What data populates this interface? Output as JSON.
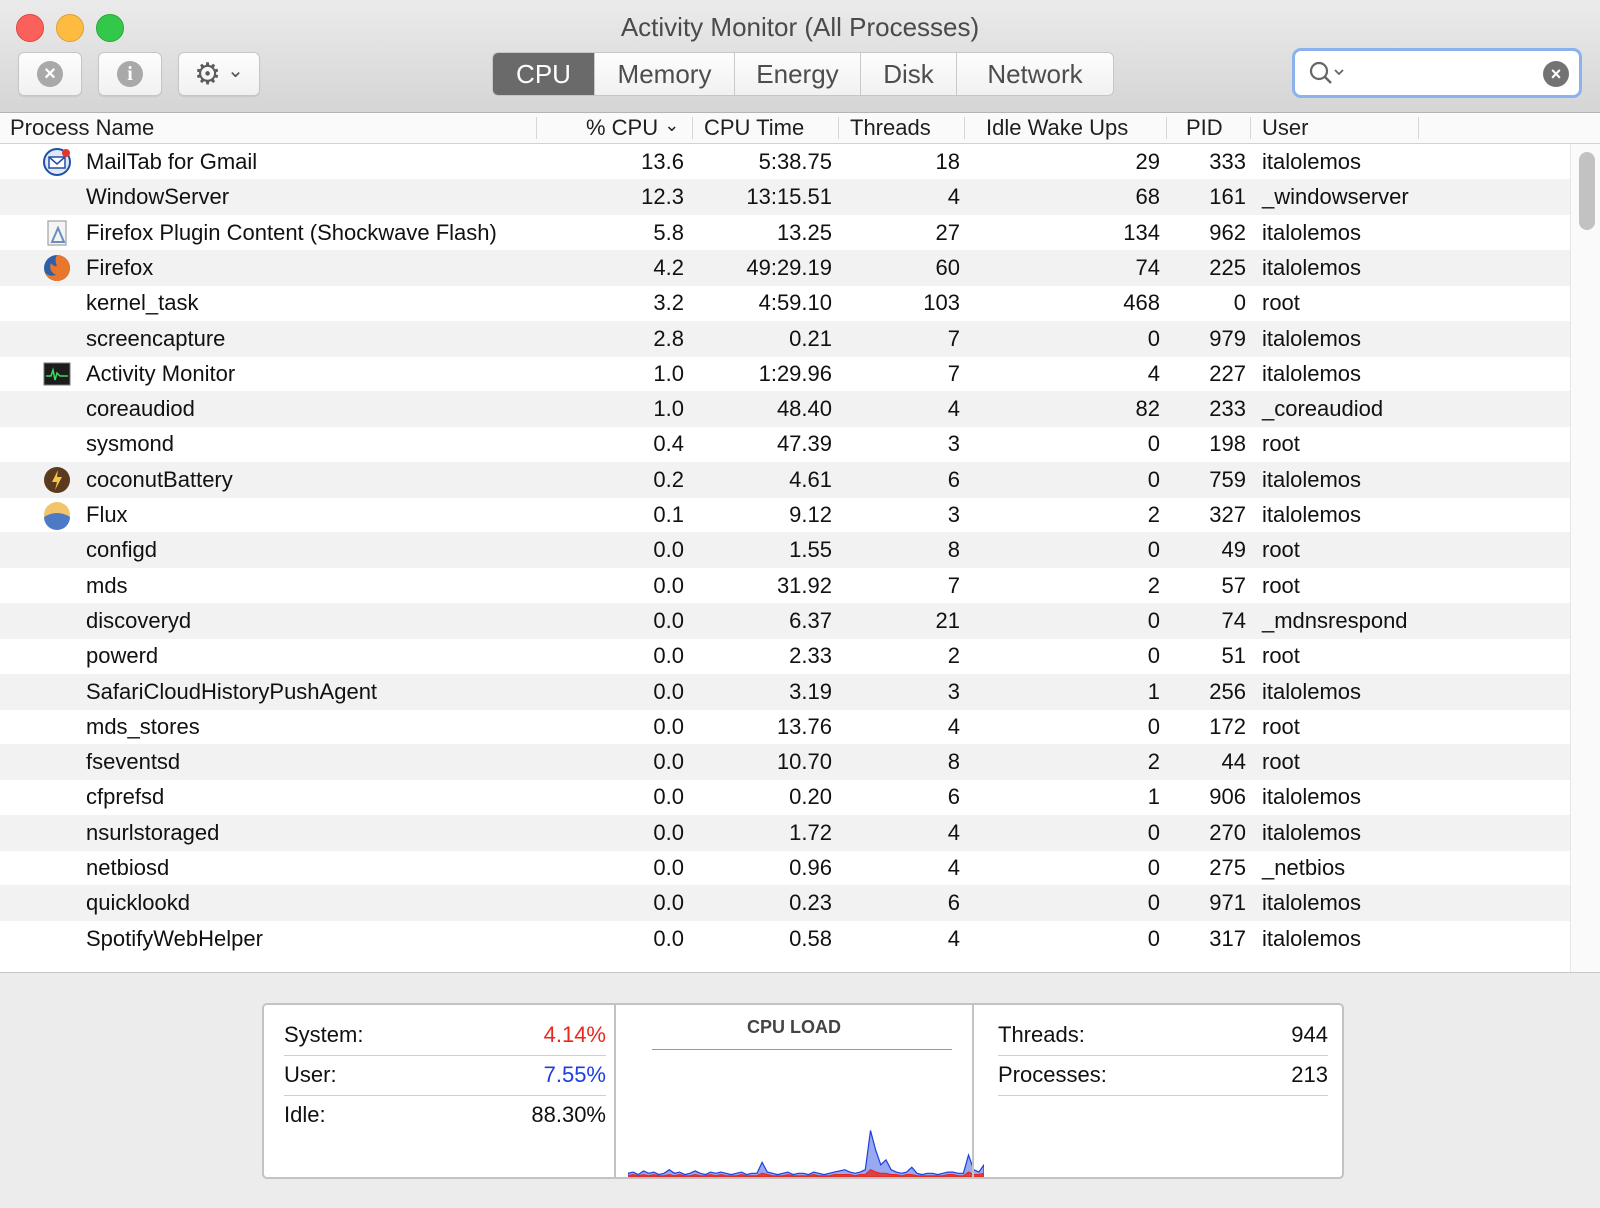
{
  "window": {
    "title": "Activity Monitor (All Processes)"
  },
  "toolbar": {
    "stop_icon": "x-circle-icon",
    "info_icon": "info-icon",
    "gear_icon": "gear-icon",
    "stop_glyph": "×",
    "info_glyph": "i",
    "gear_glyph": "⚙",
    "chevron_glyph": "⌄"
  },
  "tabs": [
    {
      "label": "CPU",
      "active": true
    },
    {
      "label": "Memory",
      "active": false
    },
    {
      "label": "Energy",
      "active": false
    },
    {
      "label": "Disk",
      "active": false
    },
    {
      "label": "Network",
      "active": false
    }
  ],
  "search": {
    "placeholder": "",
    "value": "",
    "clear_glyph": "×"
  },
  "columns": {
    "name": "Process Name",
    "cpu": "% CPU",
    "cpu_sort_glyph": "⌄",
    "time": "CPU Time",
    "threads": "Threads",
    "idle": "Idle Wake Ups",
    "pid": "PID",
    "user": "User"
  },
  "processes": [
    {
      "name": "MailTab for Gmail",
      "cpu": "13.6",
      "time": "5:38.75",
      "threads": "18",
      "idle": "29",
      "pid": "333",
      "user": "italolemos",
      "icon": "mail-icon"
    },
    {
      "name": "WindowServer",
      "cpu": "12.3",
      "time": "13:15.51",
      "threads": "4",
      "idle": "68",
      "pid": "161",
      "user": "_windowserver",
      "icon": ""
    },
    {
      "name": "Firefox Plugin Content (Shockwave Flash)",
      "cpu": "5.8",
      "time": "13.25",
      "threads": "27",
      "idle": "134",
      "pid": "962",
      "user": "italolemos",
      "icon": "plugin-icon"
    },
    {
      "name": "Firefox",
      "cpu": "4.2",
      "time": "49:29.19",
      "threads": "60",
      "idle": "74",
      "pid": "225",
      "user": "italolemos",
      "icon": "firefox-icon"
    },
    {
      "name": "kernel_task",
      "cpu": "3.2",
      "time": "4:59.10",
      "threads": "103",
      "idle": "468",
      "pid": "0",
      "user": "root",
      "icon": ""
    },
    {
      "name": "screencapture",
      "cpu": "2.8",
      "time": "0.21",
      "threads": "7",
      "idle": "0",
      "pid": "979",
      "user": "italolemos",
      "icon": ""
    },
    {
      "name": "Activity Monitor",
      "cpu": "1.0",
      "time": "1:29.96",
      "threads": "7",
      "idle": "4",
      "pid": "227",
      "user": "italolemos",
      "icon": "activity-monitor-icon"
    },
    {
      "name": "coreaudiod",
      "cpu": "1.0",
      "time": "48.40",
      "threads": "4",
      "idle": "82",
      "pid": "233",
      "user": "_coreaudiod",
      "icon": ""
    },
    {
      "name": "sysmond",
      "cpu": "0.4",
      "time": "47.39",
      "threads": "3",
      "idle": "0",
      "pid": "198",
      "user": "root",
      "icon": ""
    },
    {
      "name": "coconutBattery",
      "cpu": "0.2",
      "time": "4.61",
      "threads": "6",
      "idle": "0",
      "pid": "759",
      "user": "italolemos",
      "icon": "battery-icon"
    },
    {
      "name": "Flux",
      "cpu": "0.1",
      "time": "9.12",
      "threads": "3",
      "idle": "2",
      "pid": "327",
      "user": "italolemos",
      "icon": "flux-icon"
    },
    {
      "name": "configd",
      "cpu": "0.0",
      "time": "1.55",
      "threads": "8",
      "idle": "0",
      "pid": "49",
      "user": "root",
      "icon": ""
    },
    {
      "name": "mds",
      "cpu": "0.0",
      "time": "31.92",
      "threads": "7",
      "idle": "2",
      "pid": "57",
      "user": "root",
      "icon": ""
    },
    {
      "name": "discoveryd",
      "cpu": "0.0",
      "time": "6.37",
      "threads": "21",
      "idle": "0",
      "pid": "74",
      "user": "_mdnsrespond",
      "icon": ""
    },
    {
      "name": "powerd",
      "cpu": "0.0",
      "time": "2.33",
      "threads": "2",
      "idle": "0",
      "pid": "51",
      "user": "root",
      "icon": ""
    },
    {
      "name": "SafariCloudHistoryPushAgent",
      "cpu": "0.0",
      "time": "3.19",
      "threads": "3",
      "idle": "1",
      "pid": "256",
      "user": "italolemos",
      "icon": ""
    },
    {
      "name": "mds_stores",
      "cpu": "0.0",
      "time": "13.76",
      "threads": "4",
      "idle": "0",
      "pid": "172",
      "user": "root",
      "icon": ""
    },
    {
      "name": "fseventsd",
      "cpu": "0.0",
      "time": "10.70",
      "threads": "8",
      "idle": "2",
      "pid": "44",
      "user": "root",
      "icon": ""
    },
    {
      "name": "cfprefsd",
      "cpu": "0.0",
      "time": "0.20",
      "threads": "6",
      "idle": "1",
      "pid": "906",
      "user": "italolemos",
      "icon": ""
    },
    {
      "name": "nsurlstoraged",
      "cpu": "0.0",
      "time": "1.72",
      "threads": "4",
      "idle": "0",
      "pid": "270",
      "user": "italolemos",
      "icon": ""
    },
    {
      "name": "netbiosd",
      "cpu": "0.0",
      "time": "0.96",
      "threads": "4",
      "idle": "0",
      "pid": "275",
      "user": "_netbios",
      "icon": ""
    },
    {
      "name": "quicklookd",
      "cpu": "0.0",
      "time": "0.23",
      "threads": "6",
      "idle": "0",
      "pid": "971",
      "user": "italolemos",
      "icon": ""
    },
    {
      "name": "SpotifyWebHelper",
      "cpu": "0.0",
      "time": "0.58",
      "threads": "4",
      "idle": "0",
      "pid": "317",
      "user": "italolemos",
      "icon": ""
    }
  ],
  "summary": {
    "system_label": "System:",
    "system_value": "4.14%",
    "system_color": "#e8281e",
    "user_label": "User:",
    "user_value": "7.55%",
    "user_color": "#1b3fe0",
    "idle_label": "Idle:",
    "idle_value": "88.30%",
    "cpu_load_title": "CPU LOAD",
    "threads_label": "Threads:",
    "threads_value": "944",
    "processes_label": "Processes:",
    "processes_value": "213"
  },
  "chart_data": {
    "type": "area",
    "title": "CPU LOAD",
    "series": [
      {
        "name": "User",
        "color": "#1b3fe0",
        "values": [
          3,
          4,
          2,
          5,
          3,
          4,
          2,
          3,
          6,
          3,
          4,
          2,
          3,
          5,
          3,
          2,
          4,
          3,
          4,
          3,
          2,
          3,
          4,
          2,
          3,
          3,
          12,
          4,
          3,
          2,
          3,
          4,
          2,
          3,
          3,
          2,
          4,
          3,
          2,
          3,
          4,
          5,
          6,
          4,
          3,
          4,
          6,
          38,
          22,
          10,
          14,
          6,
          4,
          3,
          4,
          8,
          3,
          2,
          3,
          3,
          2,
          3,
          4,
          4,
          3,
          3,
          18,
          6,
          4,
          10
        ]
      },
      {
        "name": "System",
        "color": "#e8281e",
        "values": [
          1,
          2,
          1,
          2,
          1,
          2,
          1,
          1,
          2,
          1,
          2,
          1,
          1,
          2,
          1,
          1,
          2,
          1,
          2,
          1,
          1,
          1,
          2,
          1,
          1,
          1,
          3,
          2,
          1,
          1,
          1,
          2,
          1,
          1,
          1,
          1,
          2,
          1,
          1,
          1,
          2,
          2,
          2,
          2,
          1,
          2,
          2,
          6,
          4,
          3,
          3,
          2,
          2,
          1,
          2,
          2,
          1,
          1,
          1,
          1,
          1,
          1,
          2,
          2,
          1,
          1,
          4,
          2,
          2,
          3
        ]
      }
    ],
    "ylim": [
      0,
      100
    ]
  }
}
